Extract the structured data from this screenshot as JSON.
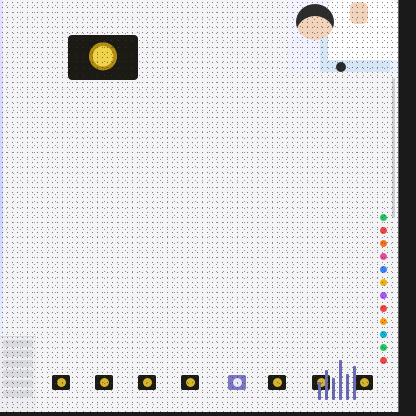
{
  "tabs": {
    "colors": [
      "#22c55e",
      "#ef4444",
      "#f97316",
      "#ec4899",
      "#3b82f6",
      "#eab308",
      "#a855f7",
      "#ef4444",
      "#f59e0b",
      "#06b6d4",
      "#22c55e",
      "#ef4444"
    ]
  },
  "cards": {
    "items": [
      {
        "icon": "product-thumbnail-icon",
        "style": "dark"
      },
      {
        "icon": "product-thumbnail-icon",
        "style": "dark"
      },
      {
        "icon": "product-thumbnail-icon",
        "style": "dark"
      },
      {
        "icon": "product-thumbnail-icon",
        "style": "dark"
      },
      {
        "icon": "product-thumbnail-icon",
        "style": "lavender"
      },
      {
        "icon": "product-thumbnail-icon",
        "style": "dark"
      },
      {
        "icon": "product-thumbnail-icon",
        "style": "dark"
      },
      {
        "icon": "product-thumbnail-icon",
        "style": "dark"
      }
    ]
  },
  "colors": {
    "background": "#f4f4f6",
    "product_dark": "#1c1a14",
    "product_gold": "#d6b52a",
    "accent_lavender": "#7d78c2"
  }
}
